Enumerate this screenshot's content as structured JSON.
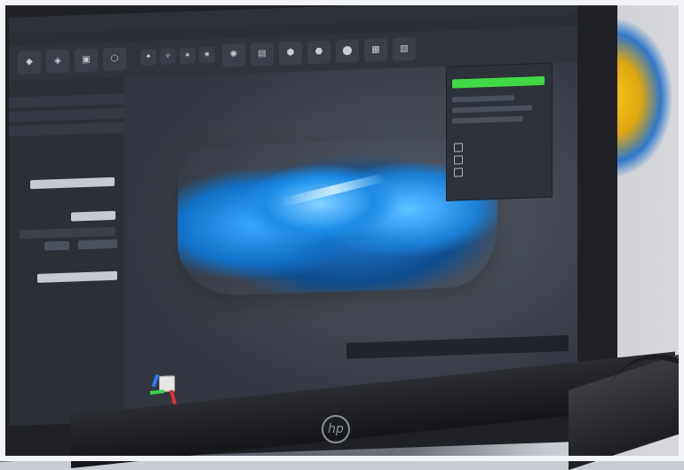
{
  "colors": {
    "screen_bg": "#3b3f48",
    "toolbar_bg": "#2f343c",
    "mesh_blue": "#2a7ec6",
    "progress_green": "#41d845"
  },
  "icons": {
    "axis_gizmo": "axis-gizmo-icon",
    "hp_logo": "hp-logo-icon"
  },
  "laptop": {
    "brand_mark": "hp"
  }
}
